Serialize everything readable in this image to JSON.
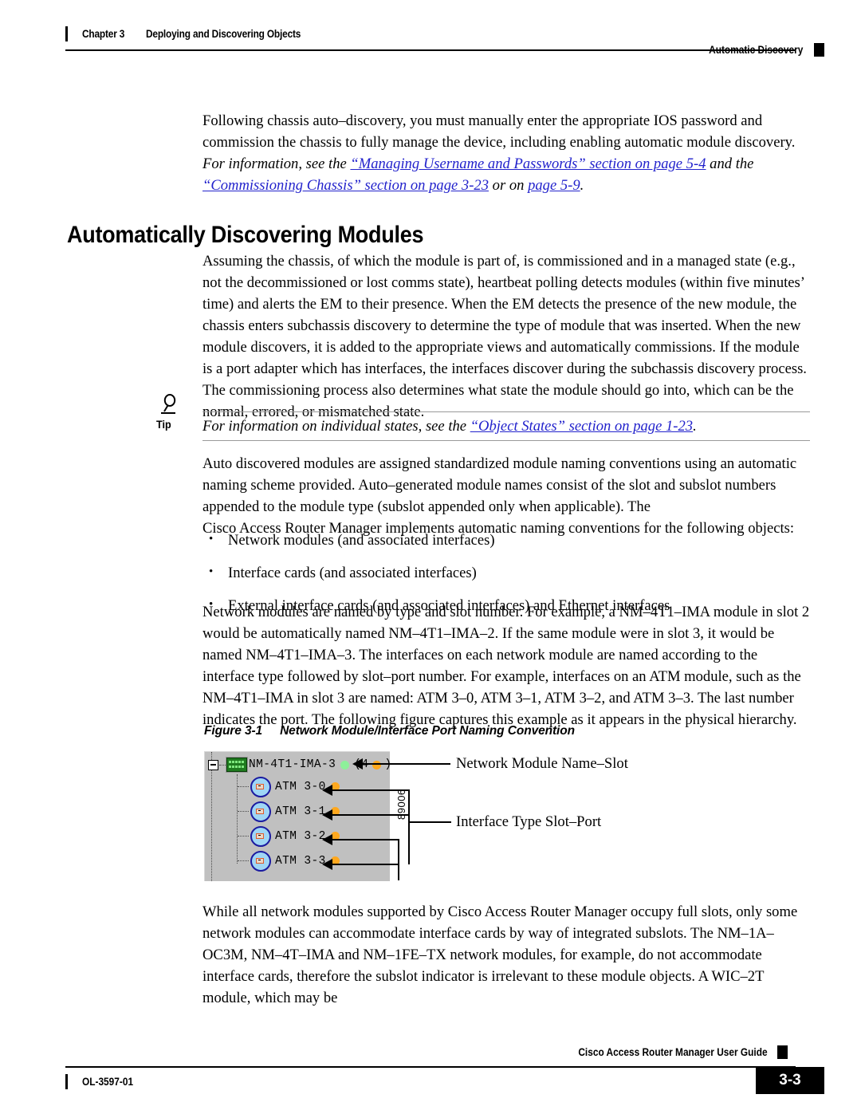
{
  "header": {
    "chapter_number": "Chapter 3",
    "chapter_title": "Deploying and Discovering Objects",
    "section": "Automatic Discovery"
  },
  "intro_paragraph": {
    "line1": "Following chassis auto–discovery, you must manually enter the appropriate IOS password and",
    "line2": "commission the chassis to fully manage the device, including enabling automatic module discovery.",
    "italic_tail": " For",
    "line3_italic_pre": "information, see the ",
    "line3_link1": "“Managing Username and Passwords” section on page 5-4",
    "line3_italic_post": " and the",
    "line4_link2": "“Commissioning Chassis” section on page 3-23",
    "line4_italic_mid": " or on ",
    "line4_link3": "page 5-9",
    "line4_tail": "."
  },
  "heading": "Automatically Discovering Modules",
  "body_paragraph_1": "Assuming the chassis, of which the module is part of, is commissioned and in a managed state (e.g., not the decommissioned or lost comms state), heartbeat polling detects modules (within five minutes’ time) and alerts the EM to their presence. When the EM detects the presence of the new module, the chassis enters subchassis discovery to determine the type of module that was inserted. When the new module discovers, it is added to the appropriate views and automatically commissions. If the module is a port adapter which has interfaces, the interfaces discover during the subchassis discovery process. The commissioning process also determines what state the module should go into, which can be the normal, errored, or mismatched state.",
  "tip": {
    "icon_name": "magnifying-glass-icon",
    "label": "Tip",
    "text_pre": "For information on individual states, see the ",
    "link": "“Object States” section on page 1-23",
    "text_post": "."
  },
  "body_paragraph_2": {
    "line1": "Auto discovered modules are assigned standardized module naming conventions using an automatic",
    "line2": "naming scheme provided. Auto–generated module names consist of the slot and subslot numbers",
    "line3": "appended to the module type (subslot appended only when applicable). The",
    "line4": "Cisco Access Router Manager implements automatic naming conventions for the following objects:"
  },
  "bullets": [
    "Network modules (and associated interfaces)",
    "Interface cards (and associated interfaces)",
    "External interface cards (and associated interfaces) and Ethernet interfaces"
  ],
  "body_paragraph_3": "Network modules are named by type and slot number. For example, a NM–4T1–IMA module in slot 2 would be automatically named NM–4T1–IMA–2. If the same module were in slot 3, it would be named NM–4T1–IMA–3. The interfaces on each network module are named according to the interface type followed by slot–port number. For example, interfaces on an ATM module, such as the NM–4T1–IMA in slot 3 are named: ATM 3–0, ATM 3–1, ATM 3–2, and ATM 3–3. The last number indicates the port. The following figure captures this example as it appears in the physical hierarchy.",
  "figure": {
    "caption_number": "Figure 3-1",
    "caption_title": "Network Module/Interface Port Naming Convention",
    "tree": {
      "root": {
        "expander": "collapse-toggle",
        "icon_name": "network-module-card-icon",
        "label": "NM-4T1-IMA-3",
        "status_dot": "green",
        "count_text_open": "(4",
        "count_text_close": ")",
        "count_dot": "orange"
      },
      "children": [
        {
          "icon_name": "interface-port-icon",
          "label": "ATM 3-0",
          "status_dot": "orange"
        },
        {
          "icon_name": "interface-port-icon",
          "label": "ATM 3-1",
          "status_dot": "orange"
        },
        {
          "icon_name": "interface-port-icon",
          "label": "ATM 3-2",
          "status_dot": "orange"
        },
        {
          "icon_name": "interface-port-icon",
          "label": "ATM 3-3",
          "status_dot": "orange"
        }
      ]
    },
    "callout_top": "Network Module Name–Slot",
    "callout_bottom": "Interface Type Slot–Port",
    "figure_id": "89006"
  },
  "body_paragraph_4": "While all network modules supported by Cisco Access Router Manager occupy full slots, only some network modules can accommodate interface cards by way of integrated subslots. The NM–1A–OC3M, NM–4T–IMA and NM–1FE–TX network modules, for example, do not accommodate interface cards, therefore the subslot indicator is irrelevant to these module objects. A WIC–2T module, which may be",
  "footer": {
    "doc_id": "OL-3597-01",
    "guide_title": "Cisco Access Router Manager User Guide",
    "page_number": "3-3"
  },
  "colors": {
    "link": "#2222cc",
    "panel_bg": "#c0c0c0",
    "status_green": "#8ef09a",
    "status_orange": "#ffa81e"
  }
}
